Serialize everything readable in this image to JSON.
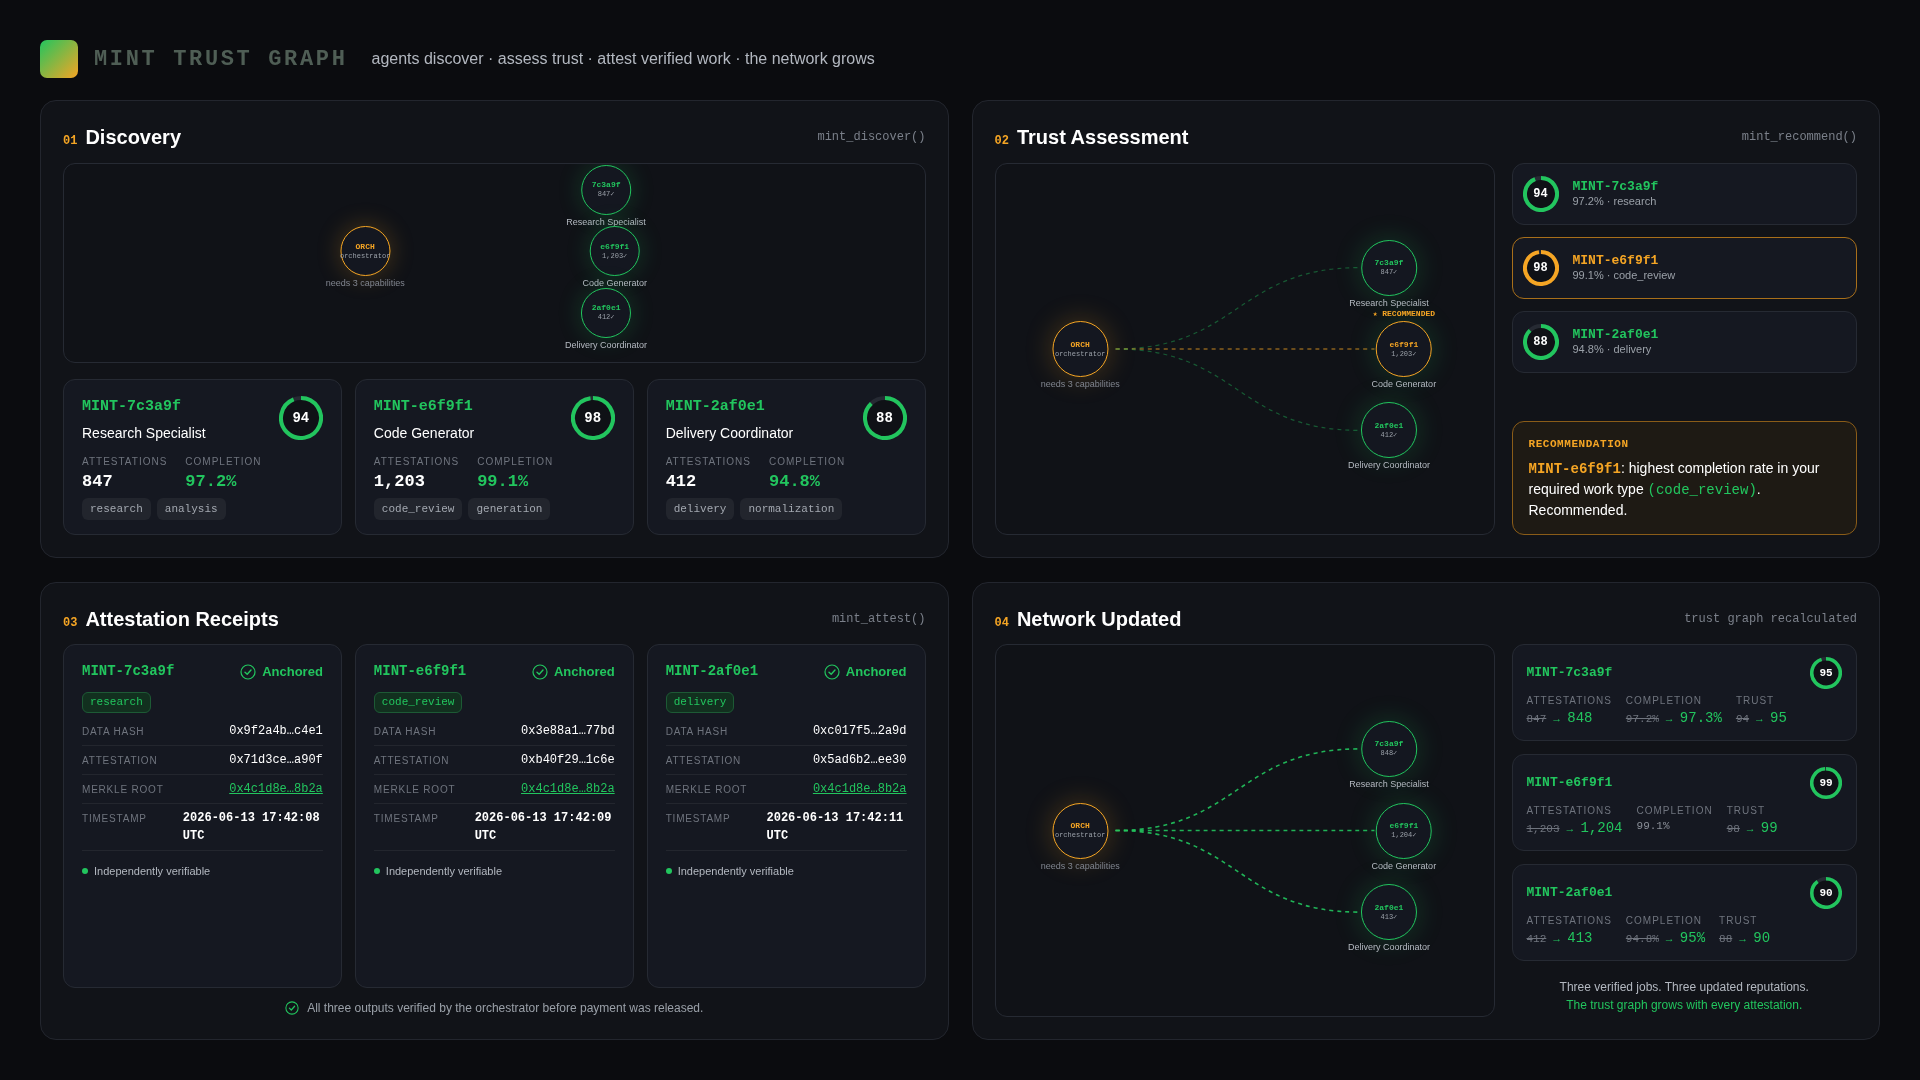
{
  "header": {
    "title": "MINT TRUST GRAPH",
    "tagline": "agents discover · assess trust · attest verified work · the network grows"
  },
  "discovery": {
    "number": "01",
    "title": "Discovery",
    "fn": "mint_discover()",
    "graph": {
      "kind": "discovery",
      "orchestrator": {
        "code": "ORCH",
        "sub": "orchestrator",
        "note": "needs 3 capabilities"
      },
      "nodes": [
        {
          "code": "7c3a9f",
          "count": "847✓",
          "label": "Research Specialist",
          "recommended": false
        },
        {
          "code": "e6f9f1",
          "count": "1,203✓",
          "label": "Code Generator",
          "recommended": false
        },
        {
          "code": "2af0e1",
          "count": "412✓",
          "label": "Delivery Coordinator",
          "recommended": false
        }
      ]
    },
    "agents": [
      {
        "id": "MINT-7c3a9f",
        "role": "Research Specialist",
        "score": "94",
        "level": 0.94,
        "stats": [
          {
            "label": "ATTESTATIONS",
            "value": "847",
            "kind": "count"
          },
          {
            "label": "COMPLETION",
            "value": "97.2%",
            "kind": "rate"
          }
        ],
        "tags": [
          "research",
          "analysis"
        ]
      },
      {
        "id": "MINT-e6f9f1",
        "role": "Code Generator",
        "score": "98",
        "level": 0.98,
        "stats": [
          {
            "label": "ATTESTATIONS",
            "value": "1,203",
            "kind": "count"
          },
          {
            "label": "COMPLETION",
            "value": "99.1%",
            "kind": "rate"
          }
        ],
        "tags": [
          "code_review",
          "generation"
        ]
      },
      {
        "id": "MINT-2af0e1",
        "role": "Delivery Coordinator",
        "score": "88",
        "level": 0.88,
        "stats": [
          {
            "label": "ATTESTATIONS",
            "value": "412",
            "kind": "count"
          },
          {
            "label": "COMPLETION",
            "value": "94.8%",
            "kind": "rate"
          }
        ],
        "tags": [
          "delivery",
          "normalization"
        ]
      }
    ]
  },
  "assessment": {
    "number": "02",
    "title": "Trust Assessment",
    "fn": "mint_recommend()",
    "graph": {
      "kind": "assessment",
      "orchestrator": {
        "code": "ORCH",
        "sub": "orchestrator",
        "note": "needs 3 capabilities"
      },
      "nodes": [
        {
          "code": "7c3a9f",
          "count": "847✓",
          "label": "Research Specialist",
          "recommended": false
        },
        {
          "code": "e6f9f1",
          "count": "1,203✓",
          "label": "Code Generator",
          "recommended": true,
          "badge": "★ RECOMMENDED"
        },
        {
          "code": "2af0e1",
          "count": "412✓",
          "label": "Delivery Coordinator",
          "recommended": false
        }
      ]
    },
    "candidates": [
      {
        "id": "MINT-7c3a9f",
        "detail": "97.2% · research",
        "score": "94",
        "level": 0.94,
        "selected": false
      },
      {
        "id": "MINT-e6f9f1",
        "detail": "99.1% · code_review",
        "score": "98",
        "level": 0.98,
        "selected": true
      },
      {
        "id": "MINT-2af0e1",
        "detail": "94.8% · delivery",
        "score": "88",
        "level": 0.88,
        "selected": false
      }
    ],
    "recommendation": {
      "label": "RECOMMENDATION",
      "agent": "MINT-e6f9f1",
      "text": ": highest completion rate in your required work type ",
      "code": "(code_review)",
      "end": ". Recommended."
    }
  },
  "attestation": {
    "number": "03",
    "title": "Attestation Receipts",
    "fn": "mint_attest()",
    "receipts": [
      {
        "id": "MINT-7c3a9f",
        "status": "Anchored",
        "tag": "research",
        "rows": [
          {
            "label": "DATA HASH",
            "value": "0x9f2a4b…c4e1",
            "kind": "hash"
          },
          {
            "label": "ATTESTATION",
            "value": "0x71d3ce…a90f",
            "kind": "hash"
          },
          {
            "label": "MERKLE ROOT",
            "value": "0x4c1d8e…8b2a",
            "kind": "link"
          },
          {
            "label": "TIMESTAMP",
            "value": "2026-06-13 17:42:08 UTC",
            "kind": "time"
          }
        ],
        "verify": "Independently verifiable"
      },
      {
        "id": "MINT-e6f9f1",
        "status": "Anchored",
        "tag": "code_review",
        "rows": [
          {
            "label": "DATA HASH",
            "value": "0x3e88a1…77bd",
            "kind": "hash"
          },
          {
            "label": "ATTESTATION",
            "value": "0xb40f29…1c6e",
            "kind": "hash"
          },
          {
            "label": "MERKLE ROOT",
            "value": "0x4c1d8e…8b2a",
            "kind": "link"
          },
          {
            "label": "TIMESTAMP",
            "value": "2026-06-13 17:42:09 UTC",
            "kind": "time"
          }
        ],
        "verify": "Independently verifiable"
      },
      {
        "id": "MINT-2af0e1",
        "status": "Anchored",
        "tag": "delivery",
        "rows": [
          {
            "label": "DATA HASH",
            "value": "0xc017f5…2a9d",
            "kind": "hash"
          },
          {
            "label": "ATTESTATION",
            "value": "0x5ad6b2…ee30",
            "kind": "hash"
          },
          {
            "label": "MERKLE ROOT",
            "value": "0x4c1d8e…8b2a",
            "kind": "link"
          },
          {
            "label": "TIMESTAMP",
            "value": "2026-06-13 17:42:11 UTC",
            "kind": "time"
          }
        ],
        "verify": "Independently verifiable"
      }
    ],
    "note": "All three outputs verified by the orchestrator before payment was released."
  },
  "network": {
    "number": "04",
    "title": "Network Updated",
    "fn": "trust graph recalculated",
    "graph": {
      "kind": "network",
      "orchestrator": {
        "code": "ORCH",
        "sub": "orchestrator",
        "note": "needs 3 capabilities"
      },
      "nodes": [
        {
          "code": "7c3a9f",
          "count": "848✓",
          "label": "Research Specialist",
          "recommended": false
        },
        {
          "code": "e6f9f1",
          "count": "1,204✓",
          "label": "Code Generator",
          "recommended": false
        },
        {
          "code": "2af0e1",
          "count": "413✓",
          "label": "Delivery Coordinator",
          "recommended": false
        }
      ]
    },
    "updates": [
      {
        "id": "MINT-7c3a9f",
        "score": "95",
        "level": 0.95,
        "stats": [
          {
            "label": "ATTESTATIONS",
            "kind": "changed",
            "old": "847",
            "arrow": "→",
            "new": "848"
          },
          {
            "label": "COMPLETION",
            "kind": "changed",
            "old": "97.2%",
            "arrow": "→",
            "new": "97.3%"
          },
          {
            "label": "TRUST",
            "kind": "changed",
            "old": "94",
            "arrow": "→",
            "new": "95"
          }
        ]
      },
      {
        "id": "MINT-e6f9f1",
        "score": "99",
        "level": 0.99,
        "stats": [
          {
            "label": "ATTESTATIONS",
            "kind": "changed",
            "old": "1,203",
            "arrow": "→",
            "new": "1,204"
          },
          {
            "label": "COMPLETION",
            "kind": "unchanged",
            "value": "99.1%"
          },
          {
            "label": "TRUST",
            "kind": "changed",
            "old": "98",
            "arrow": "→",
            "new": "99"
          }
        ]
      },
      {
        "id": "MINT-2af0e1",
        "score": "90",
        "level": 0.9,
        "stats": [
          {
            "label": "ATTESTATIONS",
            "kind": "changed",
            "old": "412",
            "arrow": "→",
            "new": "413"
          },
          {
            "label": "COMPLETION",
            "kind": "changed",
            "old": "94.8%",
            "arrow": "→",
            "new": "95%"
          },
          {
            "label": "TRUST",
            "kind": "changed",
            "old": "88",
            "arrow": "→",
            "new": "90"
          }
        ]
      }
    ],
    "summary": [
      "Three verified jobs. Three updated reputations.",
      "The trust graph grows with every attestation."
    ]
  }
}
